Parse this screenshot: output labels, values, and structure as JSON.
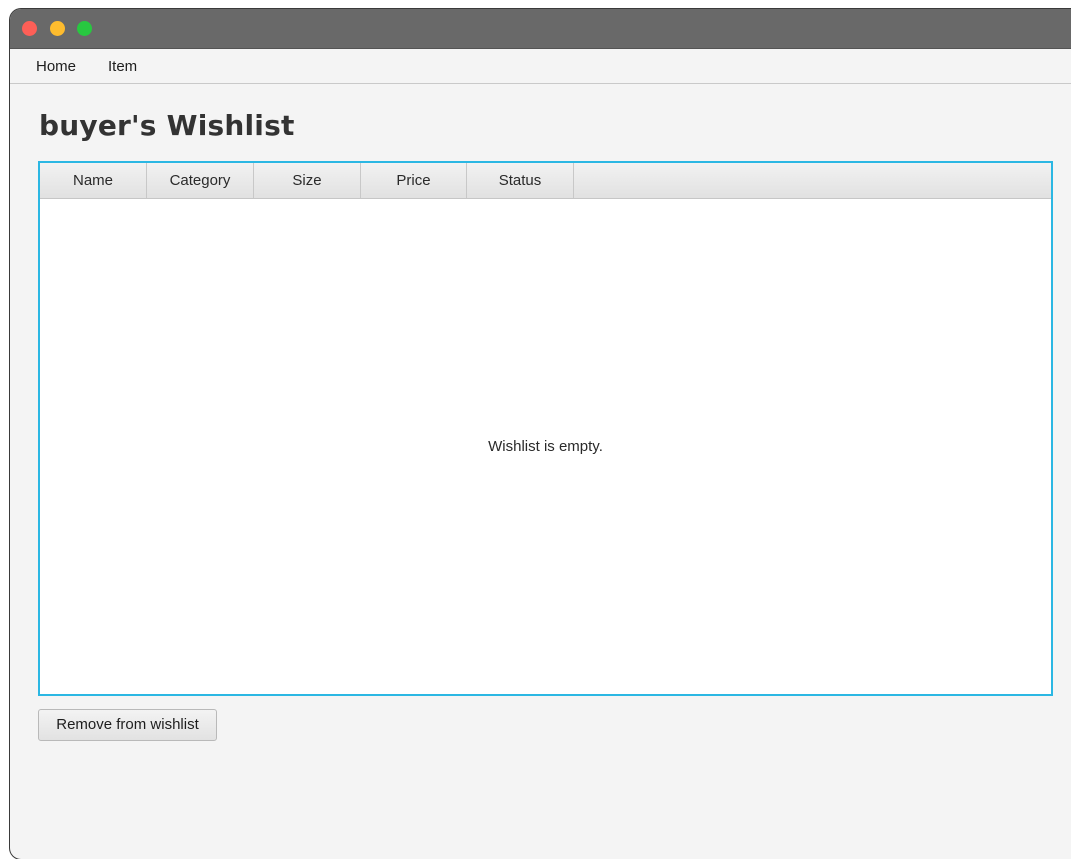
{
  "window": {
    "controls": {
      "close_icon": "close-icon",
      "minimize_icon": "minimize-icon",
      "zoom_icon": "zoom-icon"
    }
  },
  "menu": {
    "items": [
      {
        "label": "Home"
      },
      {
        "label": "Item"
      }
    ]
  },
  "page": {
    "title": "buyer's Wishlist"
  },
  "table": {
    "columns": [
      {
        "label": "Name"
      },
      {
        "label": "Category"
      },
      {
        "label": "Size"
      },
      {
        "label": "Price"
      },
      {
        "label": "Status"
      }
    ],
    "rows": [],
    "placeholder": "Wishlist is empty."
  },
  "actions": {
    "remove_label": "Remove from wishlist"
  },
  "colors": {
    "titlebar": "#696969",
    "close": "#fe5f57",
    "minimize": "#febc2e",
    "zoom": "#28c840",
    "table_focus_border": "#2bb7e3",
    "background": "#f4f4f4"
  }
}
